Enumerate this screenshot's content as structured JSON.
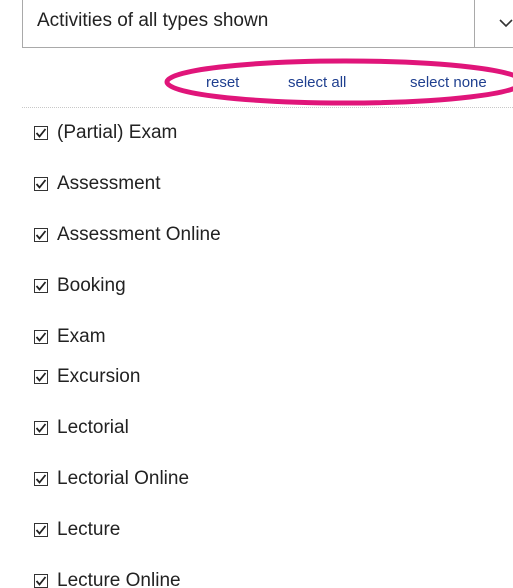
{
  "filter": {
    "selected_text": "Activities of all types shown"
  },
  "actions": {
    "reset": "reset",
    "select_all": "select all",
    "select_none": "select none"
  },
  "colors": {
    "link": "#1f3f8f",
    "highlight": "#e0157a",
    "text": "#222222"
  },
  "activity_types": [
    {
      "label": "(Partial) Exam",
      "checked": true
    },
    {
      "label": "Assessment",
      "checked": true
    },
    {
      "label": "Assessment Online",
      "checked": true
    },
    {
      "label": "Booking",
      "checked": true
    },
    {
      "label": "Exam",
      "checked": true
    },
    {
      "label": "Excursion",
      "checked": true
    },
    {
      "label": "Lectorial",
      "checked": true
    },
    {
      "label": "Lectorial Online",
      "checked": true
    },
    {
      "label": "Lecture",
      "checked": true
    },
    {
      "label": "Lecture Online",
      "checked": true
    }
  ]
}
